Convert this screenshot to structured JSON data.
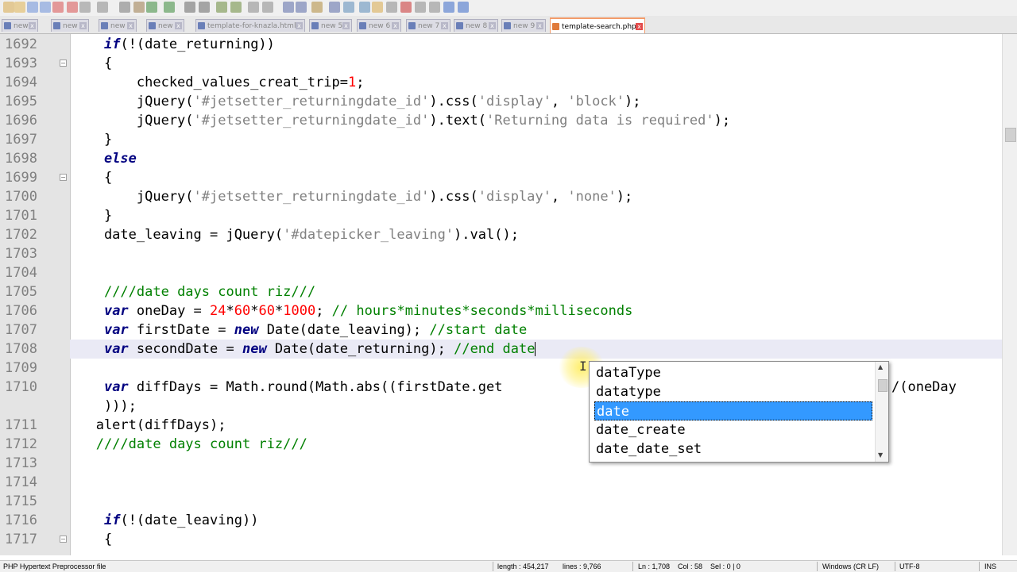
{
  "tabs": [
    {
      "label": "new 1"
    },
    {
      "label": "new 2"
    },
    {
      "label": "new 3"
    },
    {
      "label": "new 4"
    },
    {
      "label": "template-for-knazla.html"
    },
    {
      "label": "new 5"
    },
    {
      "label": "new 6"
    },
    {
      "label": "new 7"
    },
    {
      "label": "new 8"
    },
    {
      "label": "new 9"
    },
    {
      "label": "template-search.php",
      "active": true
    }
  ],
  "editor": {
    "current_line": "1708",
    "lines": [
      {
        "n": "1692",
        "fold": "",
        "segs": [
          [
            "    ",
            ""
          ],
          [
            "if",
            "kw"
          ],
          [
            "(!(date_returning))",
            ""
          ]
        ]
      },
      {
        "n": "1693",
        "fold": "open",
        "segs": [
          [
            "    {",
            ""
          ]
        ]
      },
      {
        "n": "1694",
        "fold": "",
        "segs": [
          [
            "        checked_values_creat_trip=",
            ""
          ],
          [
            "1",
            "num"
          ],
          [
            ";",
            ""
          ]
        ]
      },
      {
        "n": "1695",
        "fold": "",
        "segs": [
          [
            "        jQuery(",
            ""
          ],
          [
            "'#jetsetter_returningdate_id'",
            "str"
          ],
          [
            ").css(",
            ""
          ],
          [
            "'display'",
            "str"
          ],
          [
            ", ",
            ""
          ],
          [
            "'block'",
            "str"
          ],
          [
            ");",
            ""
          ]
        ]
      },
      {
        "n": "1696",
        "fold": "",
        "segs": [
          [
            "        jQuery(",
            ""
          ],
          [
            "'#jetsetter_returningdate_id'",
            "str"
          ],
          [
            ").text(",
            ""
          ],
          [
            "'Returning data is required'",
            "str"
          ],
          [
            ");",
            ""
          ]
        ]
      },
      {
        "n": "1697",
        "fold": "",
        "segs": [
          [
            "    }",
            ""
          ]
        ]
      },
      {
        "n": "1698",
        "fold": "",
        "segs": [
          [
            "    ",
            ""
          ],
          [
            "else",
            "kw"
          ]
        ]
      },
      {
        "n": "1699",
        "fold": "open",
        "segs": [
          [
            "    {",
            ""
          ]
        ]
      },
      {
        "n": "1700",
        "fold": "",
        "segs": [
          [
            "        jQuery(",
            ""
          ],
          [
            "'#jetsetter_returningdate_id'",
            "str"
          ],
          [
            ").css(",
            ""
          ],
          [
            "'display'",
            "str"
          ],
          [
            ", ",
            ""
          ],
          [
            "'none'",
            "str"
          ],
          [
            ");",
            ""
          ]
        ]
      },
      {
        "n": "1701",
        "fold": "",
        "segs": [
          [
            "    }",
            ""
          ]
        ]
      },
      {
        "n": "1702",
        "fold": "",
        "segs": [
          [
            "    date_leaving = jQuery(",
            ""
          ],
          [
            "'#datepicker_leaving'",
            "str"
          ],
          [
            ").val();",
            ""
          ]
        ]
      },
      {
        "n": "1703",
        "fold": "",
        "segs": [
          [
            "",
            ""
          ]
        ]
      },
      {
        "n": "1704",
        "fold": "",
        "segs": [
          [
            "",
            ""
          ]
        ]
      },
      {
        "n": "1705",
        "fold": "",
        "segs": [
          [
            "    ",
            ""
          ],
          [
            "////date days count riz///",
            "cmt"
          ]
        ]
      },
      {
        "n": "1706",
        "fold": "",
        "segs": [
          [
            "    ",
            ""
          ],
          [
            "var",
            "kw"
          ],
          [
            " oneDay = ",
            ""
          ],
          [
            "24",
            "num"
          ],
          [
            "*",
            ""
          ],
          [
            "60",
            "num"
          ],
          [
            "*",
            ""
          ],
          [
            "60",
            "num"
          ],
          [
            "*",
            ""
          ],
          [
            "1000",
            "num"
          ],
          [
            "; ",
            ""
          ],
          [
            "// hours*minutes*seconds*milliseconds",
            "cmt"
          ]
        ]
      },
      {
        "n": "1707",
        "fold": "",
        "segs": [
          [
            "    ",
            ""
          ],
          [
            "var",
            "kw"
          ],
          [
            " firstDate = ",
            ""
          ],
          [
            "new",
            "kw"
          ],
          [
            " Date(date_leaving); ",
            ""
          ],
          [
            "//start date",
            "cmt"
          ]
        ]
      },
      {
        "n": "1708",
        "fold": "",
        "segs": [
          [
            "    ",
            ""
          ],
          [
            "var",
            "kw"
          ],
          [
            " secondDate = ",
            ""
          ],
          [
            "new",
            "kw"
          ],
          [
            " Date(date_returning); ",
            ""
          ],
          [
            "//end date",
            "cmt"
          ]
        ],
        "caret": true
      },
      {
        "n": "1709",
        "fold": "",
        "segs": [
          [
            "",
            ""
          ]
        ]
      },
      {
        "n": "1710",
        "fold": "",
        "segs": [
          [
            "    ",
            ""
          ],
          [
            "var",
            "kw"
          ],
          [
            " diffDays = Math.round(Math.abs((firstDate.get",
            ""
          ]
        ],
        "tail": "/(oneDay"
      },
      {
        "n": "",
        "fold": "",
        "segs": [
          [
            "    )));",
            ""
          ]
        ]
      },
      {
        "n": "1711",
        "fold": "",
        "segs": [
          [
            "   alert(diffDays);",
            ""
          ]
        ]
      },
      {
        "n": "1712",
        "fold": "",
        "segs": [
          [
            "   ",
            ""
          ],
          [
            "////date days count riz///",
            "cmt"
          ]
        ]
      },
      {
        "n": "1713",
        "fold": "",
        "segs": [
          [
            "",
            ""
          ]
        ]
      },
      {
        "n": "1714",
        "fold": "",
        "segs": [
          [
            "",
            ""
          ]
        ]
      },
      {
        "n": "1715",
        "fold": "",
        "segs": [
          [
            "",
            ""
          ]
        ]
      },
      {
        "n": "1716",
        "fold": "",
        "segs": [
          [
            "    ",
            ""
          ],
          [
            "if",
            "kw"
          ],
          [
            "(!(date_leaving))",
            ""
          ]
        ]
      },
      {
        "n": "1717",
        "fold": "open",
        "segs": [
          [
            "    {",
            ""
          ]
        ]
      }
    ]
  },
  "autocomplete": {
    "items": [
      "dataType",
      "datatype",
      "date",
      "date_create",
      "date_date_set"
    ],
    "selected_index": 2
  },
  "status": {
    "file_type": "PHP Hypertext Preprocessor file",
    "length": "length : 454,217",
    "lines": "lines : 9,766",
    "position": "Ln : 1,708    Col : 58    Sel : 0 | 0",
    "eol": "Windows (CR LF)",
    "encoding": "UTF-8",
    "mode": "INS"
  }
}
